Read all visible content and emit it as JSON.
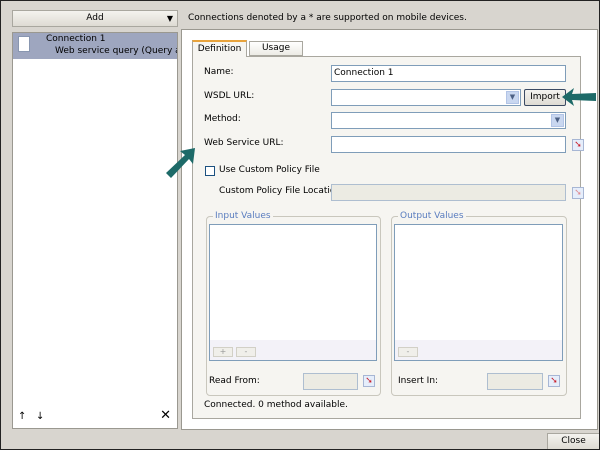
{
  "left": {
    "add_label": "Add",
    "items": [
      {
        "title": "Connection 1",
        "subtitle": "Web service query (Query as a Web Service)"
      }
    ],
    "up_icon": "arrow-up-icon",
    "down_icon": "arrow-down-icon",
    "delete_icon": "close-icon"
  },
  "header": {
    "note": "Connections denoted by a * are supported on mobile devices."
  },
  "tabs": [
    {
      "label": "Definition",
      "active": true
    },
    {
      "label": "Usage",
      "active": false
    }
  ],
  "form": {
    "name_label": "Name:",
    "name_value": "Connection 1",
    "wsdl_label": "WSDL URL:",
    "wsdl_value": "",
    "import_label": "Import",
    "method_label": "Method:",
    "method_value": "",
    "ws_url_label": "Web Service URL:",
    "ws_url_value": "",
    "custom_policy_label": "Use Custom Policy File",
    "custom_policy_checked": false,
    "policy_location_label": "Custom Policy File Location:",
    "policy_location_value": ""
  },
  "input_values": {
    "label": "Input Values",
    "add": "+",
    "remove": "-",
    "read_from_label": "Read From:"
  },
  "output_values": {
    "label": "Output Values",
    "remove": "-",
    "insert_in_label": "Insert In:"
  },
  "status": "Connected. 0 method available.",
  "footer": {
    "close_label": "Close"
  },
  "colors": {
    "selection": "#9ea6bf",
    "annotation_arrow": "#1d6a68"
  }
}
